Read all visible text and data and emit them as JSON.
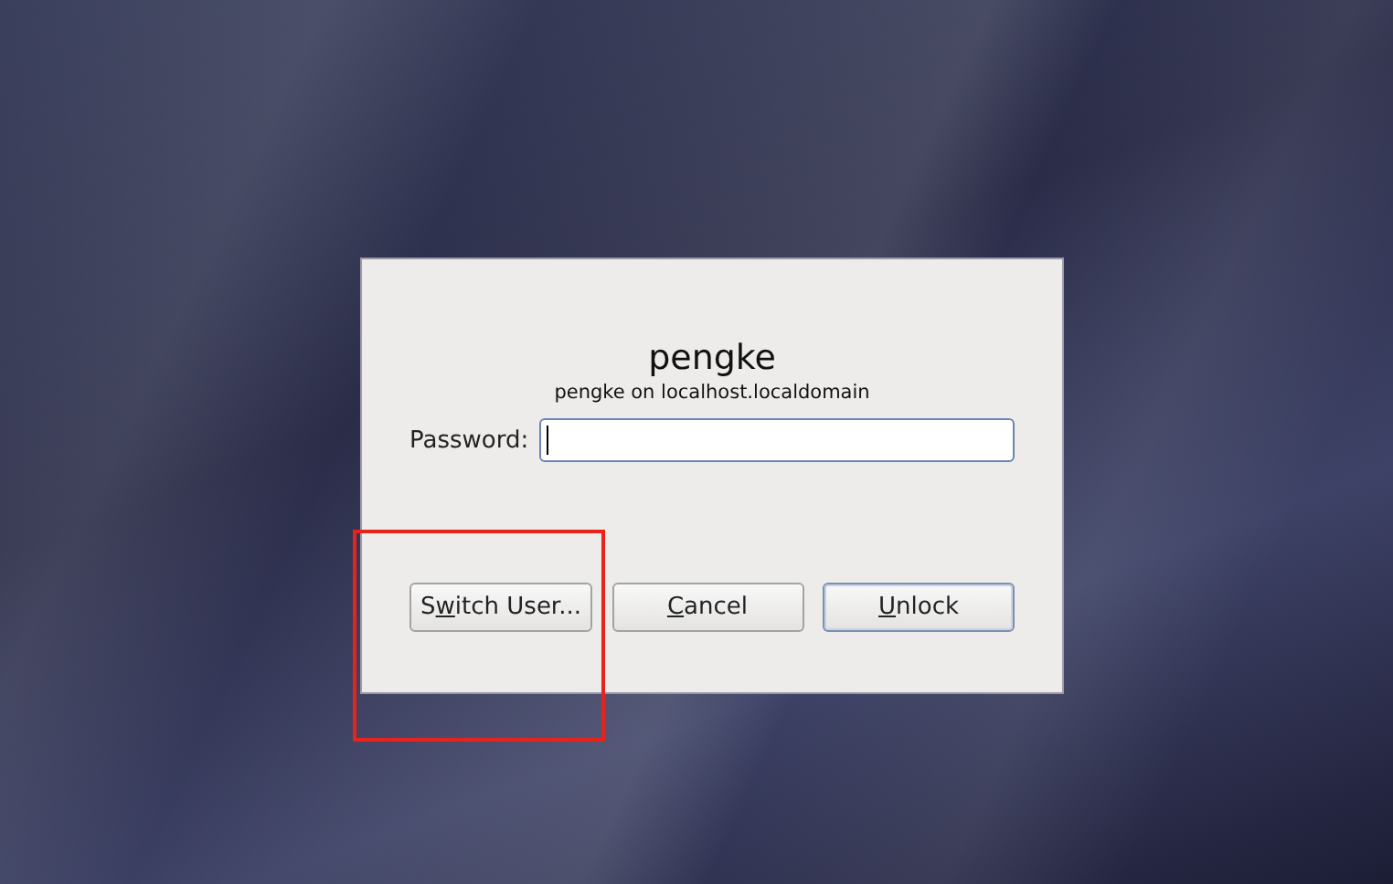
{
  "dialog": {
    "title": "pengke",
    "subtitle": "pengke on localhost.localdomain",
    "password": {
      "label": "Password:",
      "focused": true
    },
    "buttons": [
      {
        "label_start": "S",
        "mnemonic": "w",
        "label_end": "itch User...",
        "default": false
      },
      {
        "mnemonic": "C",
        "label_end": "ancel",
        "default": false
      },
      {
        "mnemonic": "U",
        "label_end": "nlock",
        "default": true
      }
    ]
  }
}
